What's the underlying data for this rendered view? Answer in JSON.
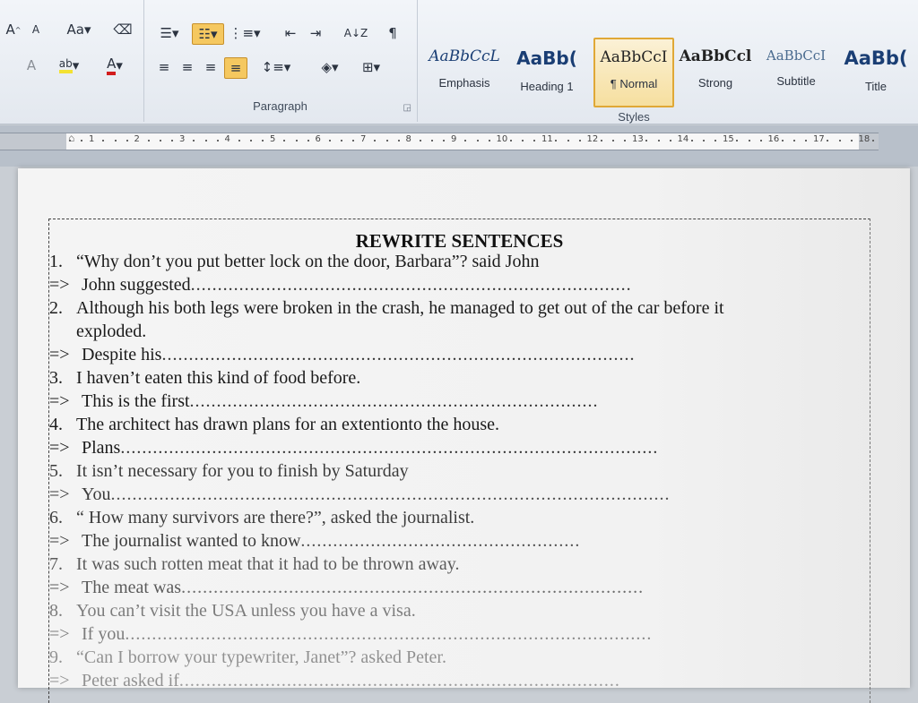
{
  "ribbon": {
    "font_group": {
      "grow_font": "A",
      "shrink_font": "A",
      "change_case": "Aa",
      "highlight_label": "ab",
      "font_color": "A"
    },
    "paragraph_group": {
      "label": "Paragraph",
      "sort": "A↓Z",
      "pilcrow": "¶"
    },
    "styles_group": {
      "label": "Styles",
      "tiles": [
        {
          "sample": "AaBbCcL",
          "name": "Emphasis"
        },
        {
          "sample": "AaBb(",
          "name": "Heading 1"
        },
        {
          "sample": "AaBbCcI",
          "name": "¶ Normal"
        },
        {
          "sample": "AaBbCcl",
          "name": "Strong"
        },
        {
          "sample": "AaBbCcI",
          "name": "Subtitle"
        },
        {
          "sample": "AaBb(",
          "name": "Title"
        }
      ]
    }
  },
  "ruler": {
    "numbers": [
      "1",
      "2",
      "3",
      "4",
      "5",
      "6",
      "7",
      "8",
      "9",
      "10",
      "11",
      "12",
      "13",
      "14",
      "15",
      "16",
      "17",
      "18"
    ]
  },
  "document": {
    "title": "REWRITE SENTENCES",
    "items": [
      {
        "num": "1.",
        "sentence": "“Why don’t you put better lock on the door, Barbara”? said John",
        "arrow": "=>",
        "prompt": "John suggested"
      },
      {
        "num": "2.",
        "sentence": "Although his both legs were broken in the crash, he managed to get out of the car before it",
        "sentence_cont": "exploded.",
        "arrow": "=>",
        "prompt": "Despite his"
      },
      {
        "num": "3.",
        "sentence": "I haven’t eaten this kind of food before.",
        "arrow": "=>",
        "prompt": "This is the first"
      },
      {
        "num": "4.",
        "sentence": "The architect has drawn plans for an extentionto the house.",
        "arrow": "=>",
        "prompt": "Plans"
      },
      {
        "num": "5.",
        "sentence": "It isn’t necessary for you to finish by Saturday",
        "arrow": "=>",
        "prompt": "You"
      },
      {
        "num": "6.",
        "sentence": "“ How many survivors are there?”, asked the journalist.",
        "arrow": "=>",
        "prompt": "The journalist wanted to know"
      },
      {
        "num": "7.",
        "sentence": "It was such rotten meat that it had to be thrown away.",
        "arrow": "=>",
        "prompt": "The meat was"
      },
      {
        "num": "8.",
        "sentence": "You can’t visit the USA unless you have a visa.",
        "arrow": "=>",
        "prompt": "If you"
      },
      {
        "num": "9.",
        "sentence": "“Can I borrow your typewriter, Janet”? asked Peter.",
        "arrow": "=>",
        "prompt": "Peter asked if"
      }
    ]
  },
  "colors": {
    "selected_style_border": "#e0a836",
    "active_button": "#f5c860",
    "page_bg": "#f3f3f3"
  }
}
